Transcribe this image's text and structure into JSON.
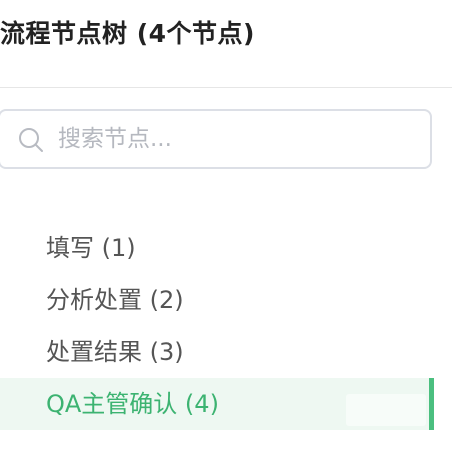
{
  "panel": {
    "title": "流程节点树 (4个节点)"
  },
  "search": {
    "placeholder": "搜索节点..."
  },
  "tree": {
    "nodes": [
      {
        "label": "填写 (1)",
        "active": false
      },
      {
        "label": "分析处置 (2)",
        "active": false
      },
      {
        "label": "处置结果 (3)",
        "active": false
      },
      {
        "label": "QA主管确认 (4)",
        "active": true
      }
    ]
  },
  "colors": {
    "accent": "#3cb371",
    "active_bg": "#eef8f2",
    "border": "#dcdfe6",
    "placeholder": "#b5b8bf"
  },
  "icons": {
    "search": "search-icon"
  }
}
